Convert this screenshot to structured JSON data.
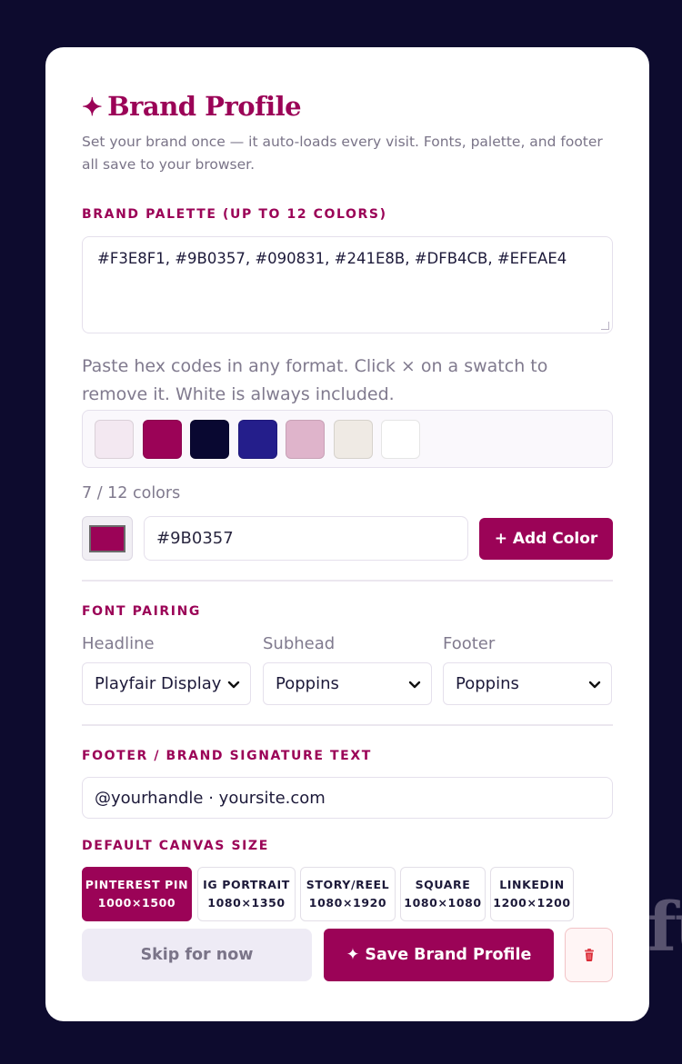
{
  "background": {
    "watermark_text": "fu"
  },
  "card": {
    "title_icon": "✦",
    "title": "Brand Profile",
    "description": "Set your brand once — it auto-loads every visit. Fonts, palette, and footer all save to your browser."
  },
  "palette": {
    "label": "BRAND PALETTE (UP TO 12 COLORS)",
    "textarea_value": "#F3E8F1, #9B0357, #090831, #241E8B, #DFB4CB, #EFEAE4",
    "hint": "Paste hex codes in any format. Click × on a swatch to remove it. White is always included.",
    "swatches": [
      "#F3E8F1",
      "#9B0357",
      "#090831",
      "#241E8B",
      "#DFB4CB",
      "#EFEAE4",
      "#FFFFFF"
    ],
    "count_text": "7 / 12 colors",
    "picker_color": "#9B0357",
    "hex_input_value": "#9B0357",
    "add_button": "+ Add Color"
  },
  "fonts": {
    "label": "FONT PAIRING",
    "headline_label": "Headline",
    "headline_value": "Playfair Display",
    "subhead_label": "Subhead",
    "subhead_value": "Poppins",
    "footer_label": "Footer",
    "footer_value": "Poppins"
  },
  "footer_text": {
    "label": "FOOTER / BRAND SIGNATURE TEXT",
    "value": "@yourhandle · yoursite.com"
  },
  "canvas": {
    "label": "DEFAULT CANVAS SIZE",
    "options": [
      {
        "name": "PINTEREST PIN",
        "size": "1000×1500",
        "active": true
      },
      {
        "name": "IG PORTRAIT",
        "size": "1080×1350",
        "active": false
      },
      {
        "name": "STORY/REEL",
        "size": "1080×1920",
        "active": false
      },
      {
        "name": "SQUARE",
        "size": "1080×1080",
        "active": false
      },
      {
        "name": "LINKEDIN",
        "size": "1200×1200",
        "active": false
      }
    ]
  },
  "actions": {
    "skip": "Skip for now",
    "save": "✦ Save Brand Profile",
    "delete_icon": "trash-icon"
  },
  "colors": {
    "accent": "#9B0357",
    "page_background": "#0D0B2E",
    "card": "#FFFFFF"
  }
}
